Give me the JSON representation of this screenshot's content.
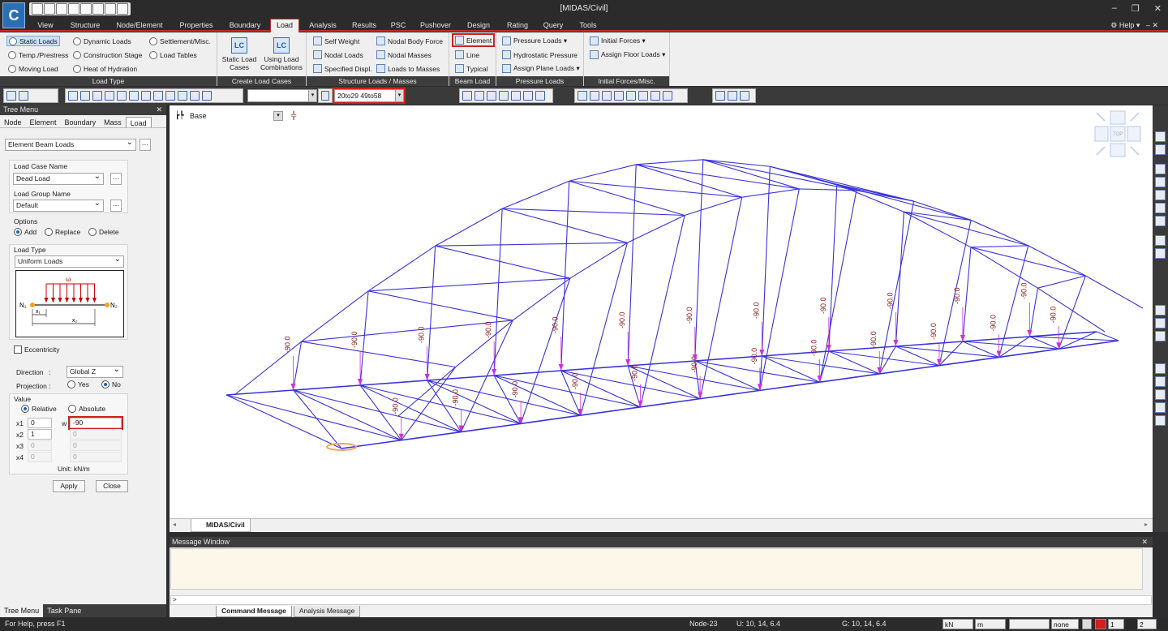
{
  "app": {
    "title": "[MIDAS/Civil]",
    "logo_letter": "C"
  },
  "window_controls": {
    "minimize": "–",
    "restore": "❐",
    "close": "✕"
  },
  "tabs": [
    "View",
    "Structure",
    "Node/Element",
    "Properties",
    "Boundary",
    "Load",
    "Analysis",
    "Results",
    "PSC",
    "Pushover",
    "Design",
    "Rating",
    "Query",
    "Tools"
  ],
  "active_tab": "Load",
  "help_label": "Help",
  "ribbon": {
    "load_type": {
      "label": "Load Type",
      "items": [
        "Static Loads",
        "Dynamic Loads",
        "Settlement/Misc.",
        "Temp./Prestress",
        "Construction Stage",
        "Load Tables",
        "Moving Load",
        "Heat of Hydration"
      ]
    },
    "create_cases": {
      "label": "Create Load Cases",
      "static_l1": "Static Load",
      "static_l2": "Cases",
      "combo_l1": "Using Load",
      "combo_l2": "Combinations",
      "lc_icon": "LC"
    },
    "structure_loads": {
      "label": "Structure Loads / Masses",
      "items": [
        "Self Weight",
        "Nodal Body Force",
        "Nodal Loads",
        "Nodal Masses",
        "Specified Displ.",
        "Loads to Masses"
      ]
    },
    "beam_load": {
      "label": "Beam Load",
      "items": [
        "Element",
        "Line",
        "Typical"
      ]
    },
    "pressure_loads": {
      "label": "Pressure Loads",
      "items": [
        "Pressure Loads ▾",
        "Hydrostatic Pressure",
        "Assign Plane Loads ▾"
      ]
    },
    "initial_forces": {
      "label": "Initial Forces/Misc.",
      "items": [
        "Initial Forces ▾",
        "Assign Floor Loads ▾"
      ]
    }
  },
  "toolbar": {
    "selection_value": "20to29 49to58"
  },
  "tree_menu": {
    "title": "Tree Menu",
    "tabs": [
      "Node",
      "Element",
      "Boundary",
      "Mass",
      "Load"
    ],
    "active_tab": "Load",
    "function": "Element Beam Loads",
    "load_case_label": "Load Case Name",
    "load_case": "Dead Load",
    "load_group_label": "Load Group Name",
    "load_group": "Default",
    "options_label": "Options",
    "options": [
      "Add",
      "Replace",
      "Delete"
    ],
    "options_selected": "Add",
    "load_type_label": "Load Type",
    "load_type": "Uniform Loads",
    "diagram": {
      "omega": "ω",
      "n1": "N₁",
      "n2": "N₂",
      "x1": "x₁",
      "x2": "x₂"
    },
    "eccentricity_label": "Eccentricity",
    "direction_label": "Direction",
    "direction_colon": ":",
    "direction": "Global Z",
    "projection_label": "Projection :",
    "projection_options": [
      "Yes",
      "No"
    ],
    "projection_selected": "No",
    "value_label": "Value",
    "value_modes": [
      "Relative",
      "Absolute"
    ],
    "value_mode_selected": "Relative",
    "rows": [
      {
        "label": "x1",
        "x": "0",
        "w": "-90"
      },
      {
        "label": "x2",
        "x": "1",
        "w": "0"
      },
      {
        "label": "x3",
        "x": "0",
        "w": "0"
      },
      {
        "label": "x4",
        "x": "0",
        "w": "0"
      }
    ],
    "w_label": "w",
    "unit_text": "Unit:  kN/m",
    "apply": "Apply",
    "close": "Close",
    "bottom_tabs": [
      "Tree Menu",
      "Task Pane"
    ]
  },
  "viewport": {
    "base_label": "Base",
    "tab_label": "MIDAS/Civil",
    "load_label": "-90.0",
    "top_label": "TOP"
  },
  "message_window": {
    "title": "Message Window",
    "prompt": ">",
    "tabs": [
      "Command Message",
      "Analysis Message"
    ]
  },
  "status": {
    "help": "For Help, press F1",
    "node": "Node-23",
    "u": "U: 10, 14, 6.4",
    "g": "G: 10, 14, 6.4",
    "force_unit": "kN",
    "length_unit": "m",
    "none": "none",
    "page1": "1",
    "page2": "2"
  },
  "colors": {
    "structure": "#3a33d6",
    "load_arrow": "#d02ed6",
    "load_text": "#8b1a1a",
    "highlight": "#d21f1f",
    "node_highlight": "#f2a65a"
  }
}
